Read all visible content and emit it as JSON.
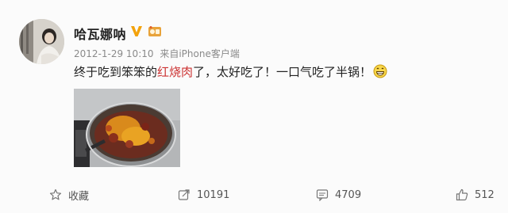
{
  "post": {
    "username": "哈瓦娜呐",
    "timestamp": "2012-1-29 10:10",
    "source_prefix": "来自",
    "source": "iPhone客户端",
    "text_before": "终于吃到笨笨的",
    "text_highlight": "红烧肉",
    "text_after": "了，太好吃了！一口气吃了半锅！"
  },
  "actions": {
    "favorite_label": "收藏",
    "forward_count": "10191",
    "comment_count": "4709",
    "like_count": "512"
  },
  "colors": {
    "verified_badge": "#f3a20b",
    "highlight_text": "#cc3333",
    "meta_text": "#8a8a8a"
  },
  "icons": [
    "verified-v-icon",
    "vip-level-icon",
    "grin-emoji-icon",
    "star-icon",
    "share-icon",
    "comment-icon",
    "thumbs-up-icon"
  ]
}
